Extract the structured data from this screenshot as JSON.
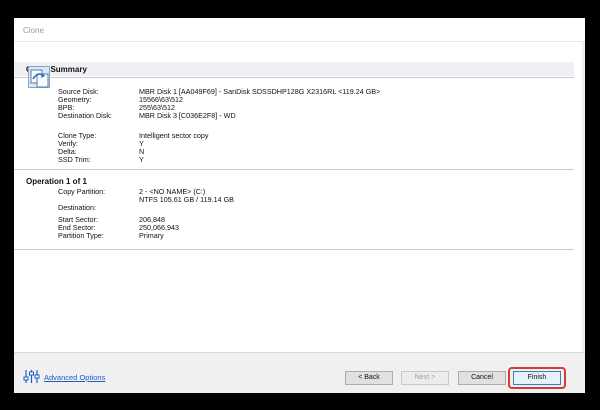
{
  "window": {
    "title": "Clone"
  },
  "summary": {
    "heading": "Clone Summary",
    "fields": [
      {
        "label": "Source Disk:",
        "value": "MBR Disk 1 [AA049F69] - SanDisk SDSSDHP128G X2316RL  <119.24 GB>"
      },
      {
        "label": "Geometry:",
        "value": "15566\\63\\512"
      },
      {
        "label": "BPB:",
        "value": "255\\63\\512"
      },
      {
        "label": "Destination Disk:",
        "value": "MBR Disk 3 [C036E2F8] - WD"
      },
      {
        "label": "Clone Type:",
        "value": "Intelligent sector copy"
      },
      {
        "label": "Verify:",
        "value": "Y"
      },
      {
        "label": "Delta:",
        "value": "N"
      },
      {
        "label": "SSD Trim:",
        "value": "Y"
      }
    ]
  },
  "operation": {
    "heading": "Operation 1 of 1",
    "fields": [
      {
        "label": "Copy Partition:",
        "value": "2 - <NO NAME> (C:)"
      },
      {
        "label": "",
        "value": "NTFS 105.61 GB / 119.14 GB"
      },
      {
        "label": "Destination:",
        "value": ""
      },
      {
        "label": "Start Sector:",
        "value": "206,848"
      },
      {
        "label": "End Sector:",
        "value": "250,066,943"
      },
      {
        "label": "Partition Type:",
        "value": "Primary"
      }
    ]
  },
  "footer": {
    "advanced_options": "Advanced Options",
    "back": "< Back",
    "next": "Next >",
    "cancel": "Cancel",
    "finish": "Finish"
  },
  "colors": {
    "link": "#1a5fc8",
    "highlight": "#d63a3a"
  }
}
